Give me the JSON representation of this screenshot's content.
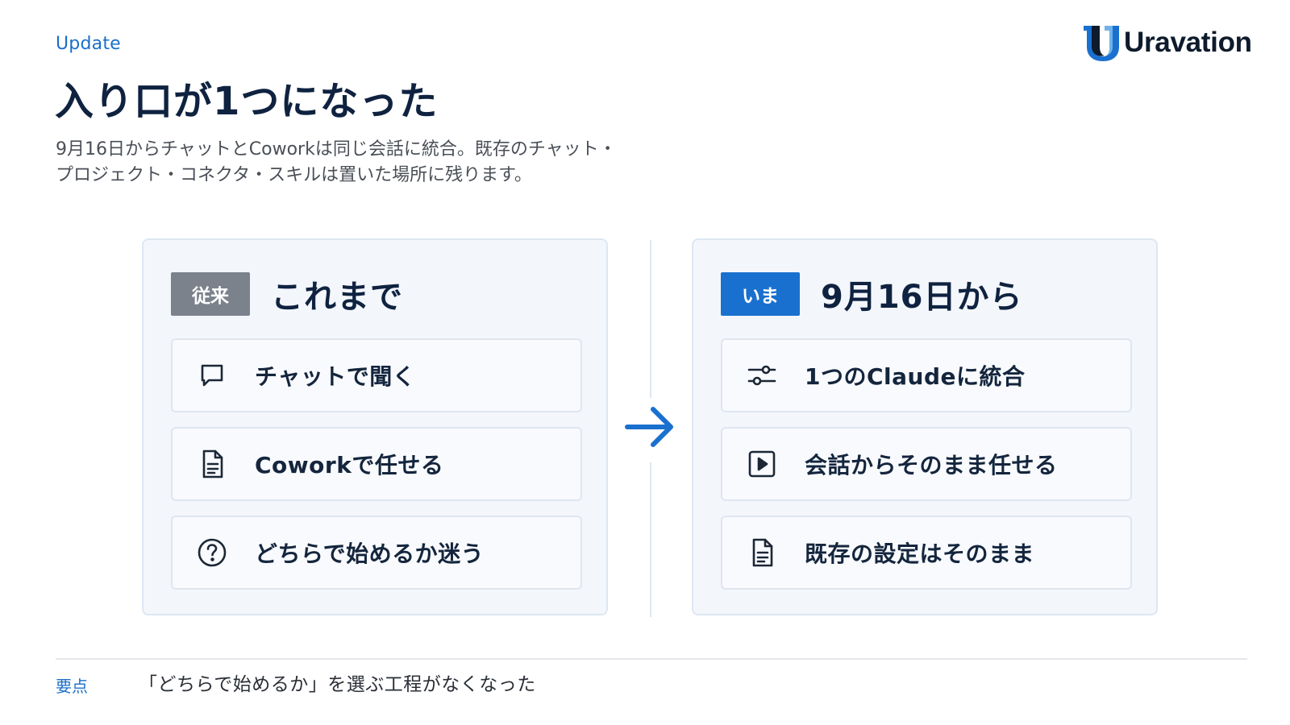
{
  "header": {
    "eyebrow": "Update",
    "title": "入り口が1つになった",
    "subtitle_lines": [
      "9月16日からチャットとCoworkは同じ会話に統合。既存のチャット・",
      "プロジェクト・コネクタ・スキルは置いた場所に残ります。"
    ]
  },
  "brand": {
    "name": "Uravation",
    "accent": "#1a70cf",
    "dark": "#0e1b2c"
  },
  "before": {
    "tag": "従来",
    "tag_color": "#7b828c",
    "title": "これまで",
    "items": [
      {
        "icon": "chat-bubble-icon",
        "label": "チャットで聞く"
      },
      {
        "icon": "document-icon",
        "label": "Coworkで任せる"
      },
      {
        "icon": "question-circle-icon",
        "label": "どちらで始めるか迷う"
      }
    ]
  },
  "after": {
    "tag": "いま",
    "tag_color": "#1a70cf",
    "title": "9月16日から",
    "items": [
      {
        "icon": "sliders-icon",
        "label": "1つのClaudeに統合"
      },
      {
        "icon": "play-square-icon",
        "label": "会話からそのまま任せる"
      },
      {
        "icon": "document-icon",
        "label": "既存の設定はそのまま"
      }
    ]
  },
  "transition_icon": "arrow-right-icon",
  "key_point": {
    "label": "要点",
    "text": "「どちらで始めるか」を選ぶ工程がなくなった"
  }
}
